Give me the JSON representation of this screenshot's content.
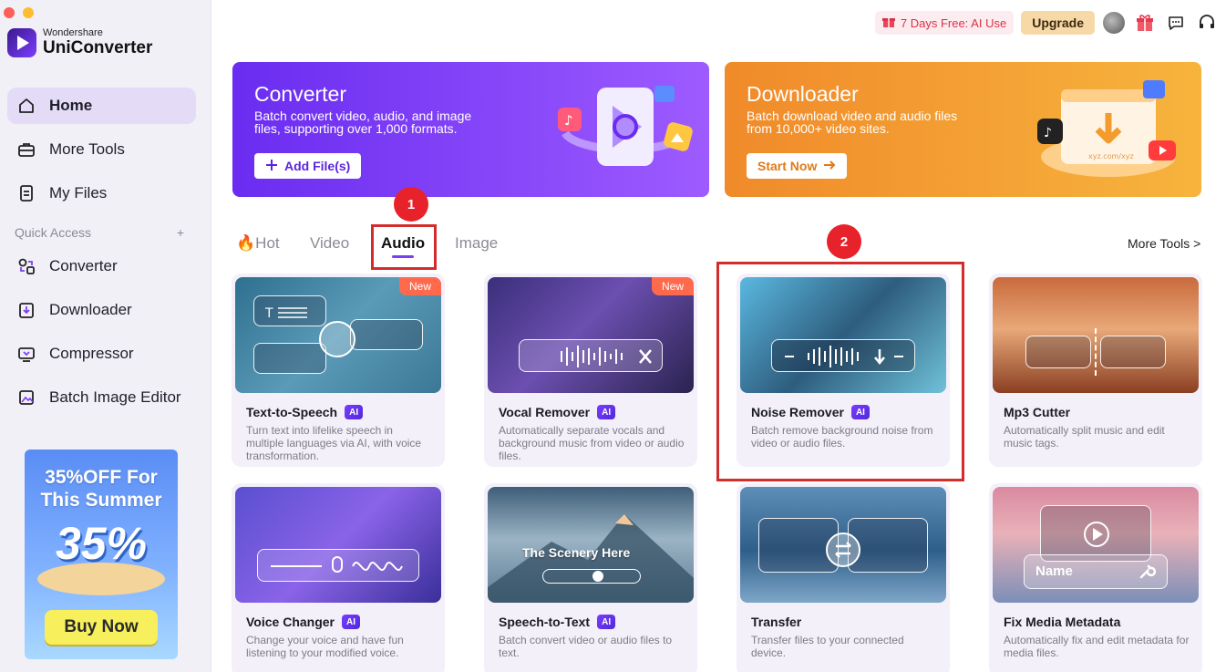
{
  "app": {
    "brand": "Wondershare",
    "product": "UniConverter"
  },
  "sidebar": {
    "items": [
      {
        "label": "Home",
        "icon": "home-icon"
      },
      {
        "label": "More Tools",
        "icon": "toolbox-icon"
      },
      {
        "label": "My Files",
        "icon": "files-icon"
      }
    ],
    "quick_access_label": "Quick Access",
    "quick_access_add": "+",
    "quick_items": [
      {
        "label": "Converter",
        "icon": "converter-icon"
      },
      {
        "label": "Downloader",
        "icon": "downloader-icon"
      },
      {
        "label": "Compressor",
        "icon": "compressor-icon"
      },
      {
        "label": "Batch Image Editor",
        "icon": "image-editor-icon"
      }
    ],
    "promo": {
      "line1": "35%OFF For",
      "line2": "This Summer",
      "big": "35%",
      "button": "Buy Now"
    }
  },
  "topbar": {
    "trial": "7 Days Free: AI Use",
    "upgrade": "Upgrade"
  },
  "banners": {
    "converter": {
      "title": "Converter",
      "desc": "Batch convert video, audio, and image files, supporting over 1,000 formats.",
      "button": "Add File(s)"
    },
    "downloader": {
      "title": "Downloader",
      "desc": "Batch download video and audio files from 10,000+ video sites.",
      "button": "Start Now",
      "url_text": "xyz.com/xyz"
    }
  },
  "tabs": {
    "hot": "Hot",
    "video": "Video",
    "audio": "Audio",
    "image": "Image",
    "more": "More Tools >"
  },
  "annotations": {
    "one": "1",
    "two": "2"
  },
  "cards": [
    {
      "title": "Text-to-Speech",
      "ai": "AI",
      "new": "New",
      "desc": "Turn text into lifelike speech in multiple languages via AI, with voice transformation."
    },
    {
      "title": "Vocal Remover",
      "ai": "AI",
      "new": "New",
      "desc": "Automatically separate vocals and background music from video or audio files."
    },
    {
      "title": "Noise Remover",
      "ai": "AI",
      "desc": "Batch remove background noise from video or audio files."
    },
    {
      "title": "Mp3 Cutter",
      "desc": "Automatically split music and edit music tags."
    },
    {
      "title": "Voice Changer",
      "ai": "AI",
      "desc": "Change your voice and have fun listening to your modified voice."
    },
    {
      "title": "Speech-to-Text",
      "ai": "AI",
      "desc": "Batch convert video or audio files to text.",
      "overlay_text": "The Scenery Here"
    },
    {
      "title": "Transfer",
      "desc": "Transfer files to your connected device."
    },
    {
      "title": "Fix Media Metadata",
      "desc": "Automatically fix and edit metadata for media files.",
      "overlay_text": "Name"
    }
  ],
  "colors": {
    "accent": "#7a3ff2",
    "highlight": "#d32c2c",
    "trial": "#d9324a"
  }
}
